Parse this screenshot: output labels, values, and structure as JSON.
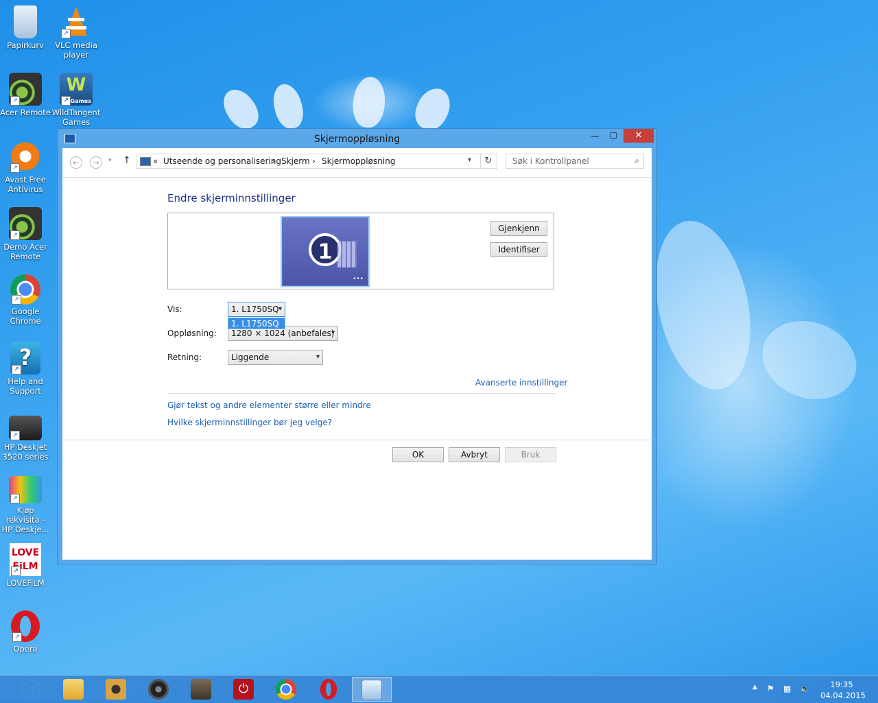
{
  "desktop": {
    "icons": [
      {
        "label": "Papirkurv",
        "icon": "recycle-bin-icon"
      },
      {
        "label": "VLC media player",
        "icon": "vlc-icon"
      },
      {
        "label": "Acer Remote",
        "icon": "acer-remote-icon"
      },
      {
        "label": "WildTangent Games",
        "icon": "wildtangent-icon"
      },
      {
        "label": "Avast Free Antivirus",
        "icon": "avast-icon"
      },
      {
        "label": "Demo Acer Remote",
        "icon": "acer-remote-icon"
      },
      {
        "label": "Google Chrome",
        "icon": "chrome-icon"
      },
      {
        "label": "Help and Support",
        "icon": "help-icon"
      },
      {
        "label": "HP Deskjet 3520 series",
        "icon": "printer-icon"
      },
      {
        "label": "Kjøp rekvisita - HP Deskje...",
        "icon": "printer-supplies-icon"
      },
      {
        "label": "LOVEFiLM",
        "icon": "lovefilm-icon"
      },
      {
        "label": "Opera",
        "icon": "opera-icon"
      }
    ],
    "wildtangent_badge": "Games",
    "lovefilm_logo": "LOVE FiLM"
  },
  "window": {
    "title": "Skjermoppløsning",
    "minimize": "—",
    "maximize": "☐",
    "close": "✕",
    "breadcrumb": {
      "prefix": "«",
      "items": [
        "Utseende og personalisering",
        "Skjerm",
        "Skjermoppløsning"
      ],
      "separator": "›"
    },
    "search_placeholder": "Søk i Kontrollpanel",
    "heading": "Endre skjerminnstillinger",
    "monitor_number": "1",
    "detect_button": "Gjenkjenn",
    "identify_button": "Identifiser",
    "display_label": "Vis:",
    "display_value": "1. L1750SQ",
    "display_dropdown_option": "1. L1750SQ",
    "resolution_label": "Oppløsning:",
    "resolution_value": "1280 × 1024 (anbefales)",
    "orientation_label": "Retning:",
    "orientation_value": "Liggende",
    "advanced_link": "Avanserte innstillinger",
    "link_text_size": "Gjør tekst og andre elementer større eller mindre",
    "link_which_settings": "Hvilke skjerminnstillinger bør jeg velge?",
    "ok_button": "OK",
    "cancel_button": "Avbryt",
    "apply_button": "Bruk"
  },
  "taskbar": {
    "items": [
      "internet-explorer-icon",
      "file-explorer-icon",
      "media-icon",
      "speaker-icon",
      "doc-icon",
      "power-icon",
      "chrome-icon",
      "opera-icon",
      "control-panel-icon"
    ],
    "time": "19:35",
    "date": "04.04.2015"
  }
}
